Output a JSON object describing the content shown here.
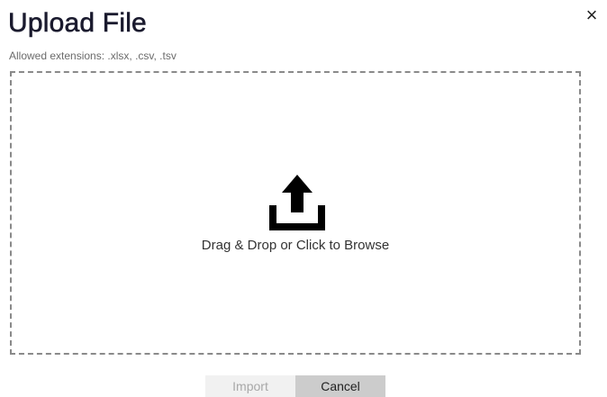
{
  "dialog": {
    "title": "Upload File",
    "close_glyph": "×",
    "subtitle": "Allowed extensions: .xlsx, .csv, .tsv"
  },
  "dropzone": {
    "icon": "upload-icon",
    "label": "Drag & Drop or Click to Browse"
  },
  "buttons": {
    "import_label": "Import",
    "cancel_label": "Cancel"
  },
  "colors": {
    "title": "#1a1a2e",
    "dashed_border": "#8a8a8a",
    "import_bg": "#f1f1f1",
    "cancel_bg": "#cccccc"
  }
}
